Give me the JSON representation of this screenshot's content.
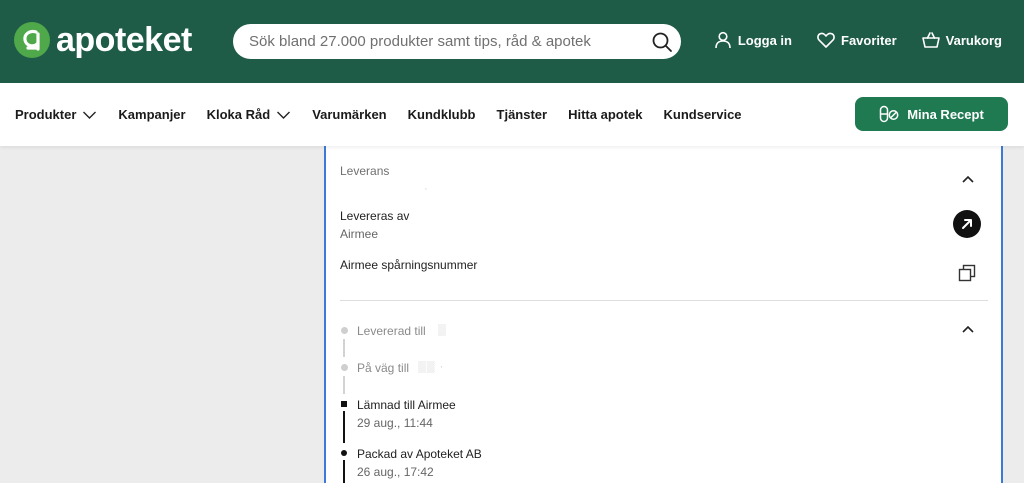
{
  "header": {
    "logo_text": "apoteket",
    "search_placeholder": "Sök bland 27.000 produkter samt tips, råd & apotek",
    "actions": [
      {
        "label": "Logga in",
        "icon": "user-icon"
      },
      {
        "label": "Favoriter",
        "icon": "heart-icon"
      },
      {
        "label": "Varukorg",
        "icon": "basket-icon"
      }
    ]
  },
  "nav": {
    "items": [
      {
        "label": "Produkter",
        "has_dropdown": true
      },
      {
        "label": "Kampanjer",
        "has_dropdown": false
      },
      {
        "label": "Kloka Råd",
        "has_dropdown": true
      },
      {
        "label": "Varumärken",
        "has_dropdown": false
      },
      {
        "label": "Kundklubb",
        "has_dropdown": false
      },
      {
        "label": "Tjänster",
        "has_dropdown": false
      },
      {
        "label": "Hitta apotek",
        "has_dropdown": false
      },
      {
        "label": "Kundservice",
        "has_dropdown": false
      }
    ],
    "cta_label": "Mina Recept"
  },
  "delivery": {
    "section_title": "Leverans",
    "delivered_by_label": "Levereras av",
    "delivered_by_value": "Airmee",
    "tracking_label": "Airmee spårningsnummer",
    "timeline": [
      {
        "label": "Levererad till",
        "time": "",
        "state": "pending"
      },
      {
        "label": "På väg till",
        "time": "",
        "state": "pending"
      },
      {
        "label": "Lämnad till Airmee",
        "time": "29 aug., 11:44",
        "state": "done"
      },
      {
        "label": "Packad av Apoteket AB",
        "time": "26 aug., 17:42",
        "state": "done"
      }
    ]
  },
  "colors": {
    "brand_dark_green": "#1f5c48",
    "brand_green": "#1f7a52",
    "logo_green": "#4fa84a",
    "focus_blue": "#3d7ad6"
  }
}
